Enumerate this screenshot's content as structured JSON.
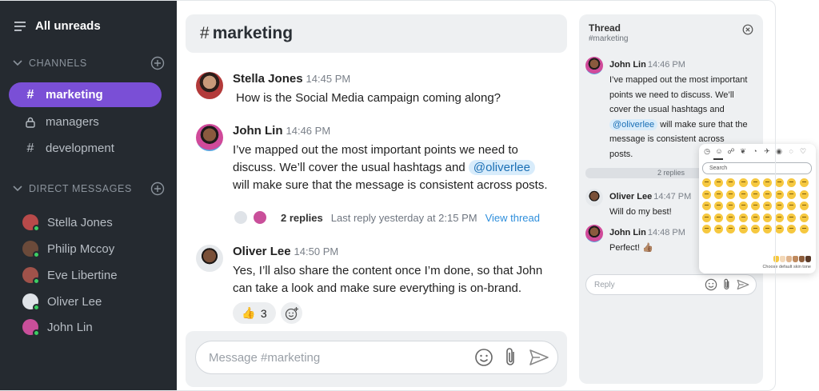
{
  "sidebar": {
    "title": "All unreads",
    "channels_header": "CHANNELS",
    "channels": [
      {
        "label": "marketing",
        "icon": "hash-icon",
        "active": true
      },
      {
        "label": "managers",
        "icon": "lock-icon",
        "active": false
      },
      {
        "label": "development",
        "icon": "hash-icon",
        "active": false
      }
    ],
    "dm_header": "DIRECT MESSAGES",
    "direct_messages": [
      {
        "label": "Stella Jones"
      },
      {
        "label": "Philip Mccoy"
      },
      {
        "label": "Eve Libertine"
      },
      {
        "label": "Oliver Lee"
      },
      {
        "label": "John Lin"
      }
    ]
  },
  "channel": {
    "hash": "#",
    "name": "marketing"
  },
  "messages": [
    {
      "name": "Stella Jones",
      "time": "14:45 PM",
      "text": "How is the Social Media campaign coming along?"
    },
    {
      "name": "John Lin",
      "time": "14:46 PM",
      "text_1": "I’ve mapped out the most important points we need to",
      "text_2": "discuss. We’ll cover the usual hashtags and",
      "mention": "@oliverlee",
      "text_3": "will make sure that the message is consistent across posts."
    },
    {
      "name": "Oliver Lee",
      "time": "14:50 PM",
      "text_1": "Yes, I’ll also share the content once I’m done, so that John",
      "text_2": "can take a look and make sure everything is on-brand."
    }
  ],
  "thread_summary": {
    "count": "2 replies",
    "last": "Last reply yesterday at 2:15 PM",
    "link": "View thread"
  },
  "reaction": {
    "emoji": "👍",
    "count": "3"
  },
  "composer": {
    "placeholder": "Message #marketing"
  },
  "thread": {
    "title": "Thread",
    "channel": "#marketing",
    "root": {
      "name": "John Lin",
      "time": "14:46 PM",
      "l1": "I’ve mapped out the most important",
      "l2": "points we need to discuss. We’ll",
      "l3": "cover the usual hashtags and",
      "mention": "@oliverlee",
      "l4": "will make sure that the",
      "l5": "message is consistent across",
      "l6": "posts."
    },
    "divider": "2 replies",
    "replies": [
      {
        "name": "Oliver Lee",
        "time": "14:47 PM",
        "text": "Will do my best!"
      },
      {
        "name": "John Lin",
        "time": "14:48 PM",
        "text": "Perfect! 👍🏽"
      }
    ],
    "reply_placeholder": "Reply"
  },
  "emoji_picker": {
    "search_placeholder": "Search",
    "tone_label": "Choose default skin tone",
    "categories": [
      "clock-icon",
      "smiley-icon",
      "person-icon",
      "leaf-icon",
      "food-icon",
      "plane-icon",
      "ball-icon",
      "bulb-icon",
      "heart-icon"
    ]
  },
  "colors": {
    "accent": "#7a4fd6",
    "sidebar": "#252a30",
    "link": "#2f8fdc",
    "online": "#3ccf63"
  }
}
